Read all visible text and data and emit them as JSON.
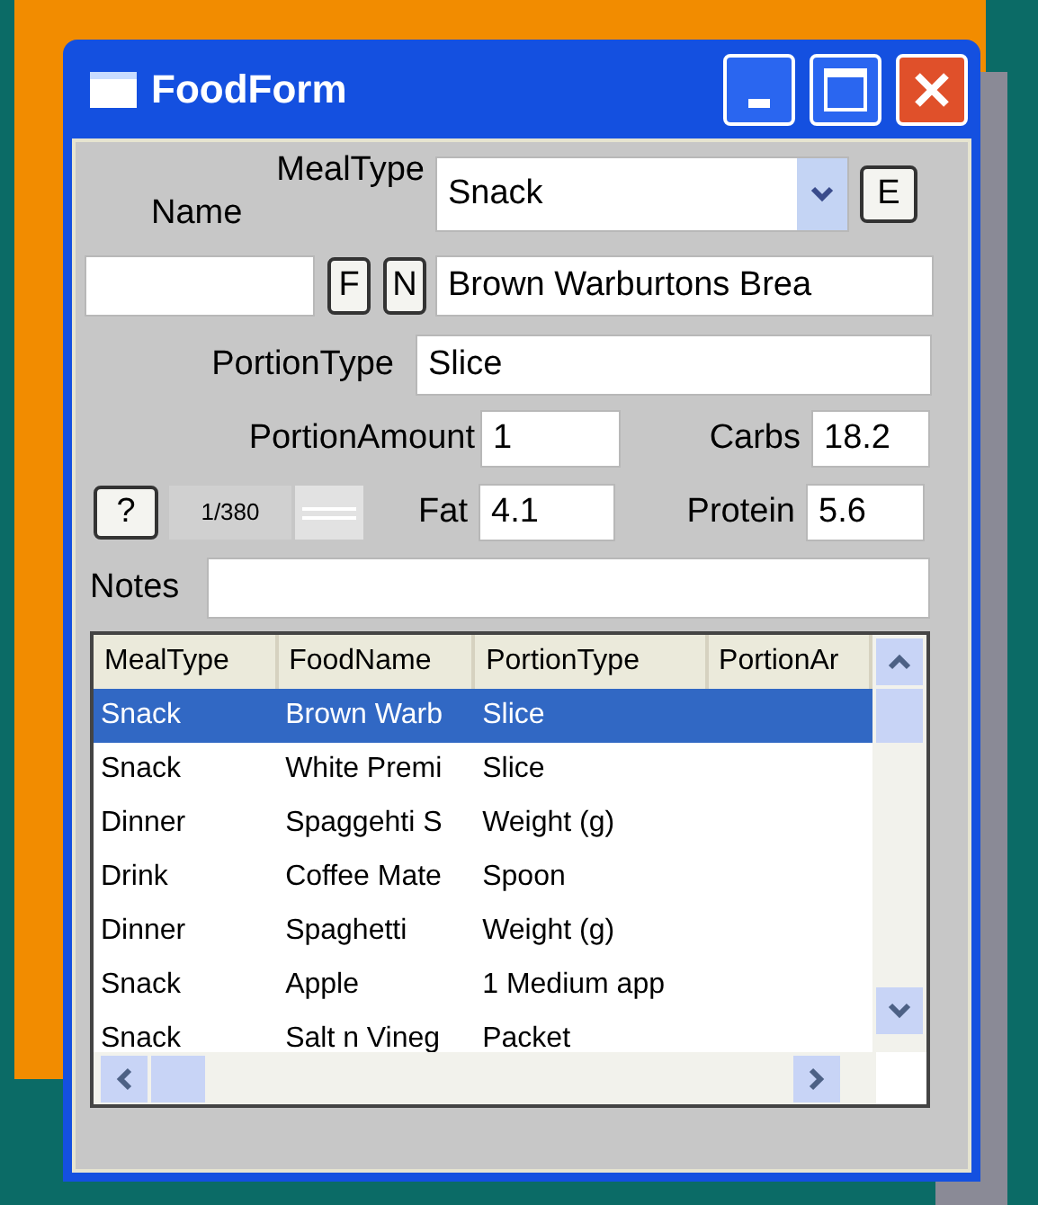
{
  "window": {
    "title": "FoodForm"
  },
  "meal_type": {
    "label": "MealType",
    "value": "Snack"
  },
  "edit_button": "E",
  "name": {
    "label": "Name",
    "buttons": [
      "F",
      "N"
    ],
    "value": "Brown Warburtons Brea"
  },
  "portion_type": {
    "label": "PortionType",
    "value": "Slice"
  },
  "portion_amount": {
    "label": "PortionAmount",
    "value": "1"
  },
  "carbs": {
    "label": "Carbs",
    "value": "18.2"
  },
  "help_button": "?",
  "record_position": "1/380",
  "fat": {
    "label": "Fat",
    "value": "4.1"
  },
  "protein": {
    "label": "Protein",
    "value": "5.6"
  },
  "notes": {
    "label": "Notes"
  },
  "table": {
    "columns": [
      "MealType",
      "FoodName",
      "PortionType",
      "PortionAr"
    ],
    "rows": [
      {
        "cells": [
          "Snack",
          "Brown Warb",
          "Slice"
        ],
        "selected": true
      },
      {
        "cells": [
          "Snack",
          "White Premi",
          "Slice"
        ],
        "selected": false
      },
      {
        "cells": [
          "Dinner",
          "Spaggehti S",
          "Weight (g)"
        ],
        "selected": false
      },
      {
        "cells": [
          "Drink",
          "Coffee Mate",
          "Spoon"
        ],
        "selected": false
      },
      {
        "cells": [
          "Dinner",
          "Spaghetti",
          "Weight (g)"
        ],
        "selected": false
      },
      {
        "cells": [
          "Snack",
          "Apple",
          "1 Medium app"
        ],
        "selected": false
      },
      {
        "cells": [
          "Snack",
          "Salt n Vineg",
          "Packet"
        ],
        "selected": false
      }
    ]
  }
}
